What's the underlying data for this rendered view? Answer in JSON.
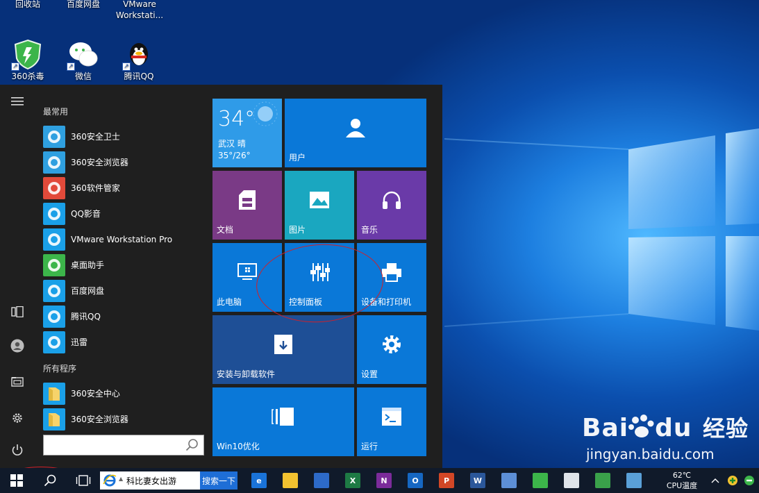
{
  "desktop": {
    "icons": [
      {
        "label": "回收站",
        "icon": "recycle-bin-icon"
      },
      {
        "label": "百度网盘",
        "icon": "baidu-netdisk-icon"
      },
      {
        "label": "VMware Workstati...",
        "icon": "vmware-icon"
      },
      {
        "label": "360杀毒",
        "icon": "360-antivirus-icon"
      },
      {
        "label": "微信",
        "icon": "wechat-icon"
      },
      {
        "label": "腾讯QQ",
        "icon": "qq-penguin-icon"
      }
    ]
  },
  "start_menu": {
    "most_used_header": "最常用",
    "all_programs_header": "所有程序",
    "most_used": [
      {
        "label": "360安全卫士",
        "color": "#2fa0e0",
        "icon": "360-security-icon"
      },
      {
        "label": "360安全浏览器",
        "color": "#2fa0e0",
        "icon": "360-browser-icon"
      },
      {
        "label": "360软件管家",
        "color": "#e24a3a",
        "icon": "360-software-icon"
      },
      {
        "label": "QQ影音",
        "color": "#1aa0e8",
        "icon": "qq-player-icon"
      },
      {
        "label": "VMware Workstation Pro",
        "color": "#1aa0e8",
        "icon": "vmware-icon"
      },
      {
        "label": "桌面助手",
        "color": "#3cb54a",
        "icon": "desktop-helper-icon"
      },
      {
        "label": "百度网盘",
        "color": "#1aa0e8",
        "icon": "baidu-netdisk-icon"
      },
      {
        "label": "腾讯QQ",
        "color": "#1aa0e8",
        "icon": "qq-penguin-icon"
      },
      {
        "label": "迅雷",
        "color": "#1aa0e8",
        "icon": "xunlei-icon"
      }
    ],
    "all_programs": [
      {
        "label": "360安全中心",
        "color": "#1aa0e8",
        "icon": "folder-icon"
      },
      {
        "label": "360安全浏览器",
        "color": "#1aa0e8",
        "icon": "folder-icon"
      }
    ],
    "search_placeholder": "",
    "tiles": {
      "weather": {
        "temp": "34°",
        "city": "武汉 晴",
        "range": "35°/26°",
        "color": "#2f9be8"
      },
      "user": {
        "label": "用户",
        "color": "#0a78d8"
      },
      "documents": {
        "label": "文档",
        "color": "#7a3a86"
      },
      "pictures": {
        "label": "图片",
        "color": "#1aa7c0"
      },
      "music": {
        "label": "音乐",
        "color": "#6a3aa8"
      },
      "this_pc": {
        "label": "此电脑",
        "color": "#0a78d8"
      },
      "control_panel": {
        "label": "控制面板",
        "color": "#0a78d8"
      },
      "devices_printers": {
        "label": "设备和打印机",
        "color": "#0a78d8"
      },
      "install_uninstall": {
        "label": "安装与卸载软件",
        "color": "#1e4f96"
      },
      "settings": {
        "label": "设置",
        "color": "#0a78d8"
      },
      "win10_optimize": {
        "label": "Win10优化",
        "color": "#0a78d8"
      },
      "run": {
        "label": "运行",
        "color": "#0a78d8"
      }
    }
  },
  "taskbar": {
    "ie_search_text": "科比妻女出游",
    "search_button": "搜索一下",
    "temp_value": "62℃",
    "temp_label": "CPU温度",
    "apps": [
      {
        "icon": "edge-icon",
        "text": "e",
        "color": "#1a73d8"
      },
      {
        "icon": "file-explorer-icon",
        "text": "",
        "color": "#f2c230"
      },
      {
        "icon": "store-icon",
        "text": "",
        "color": "#2d6ac8"
      },
      {
        "icon": "excel-icon",
        "text": "X",
        "color": "#1e7a44"
      },
      {
        "icon": "onenote-icon",
        "text": "N",
        "color": "#7b2b9a"
      },
      {
        "icon": "outlook-icon",
        "text": "O",
        "color": "#1667c2"
      },
      {
        "icon": "powerpoint-icon",
        "text": "P",
        "color": "#d24726"
      },
      {
        "icon": "word-icon",
        "text": "W",
        "color": "#2b579a"
      },
      {
        "icon": "paint-icon",
        "text": "",
        "color": "#5d8fd6"
      },
      {
        "icon": "360-security-icon",
        "text": "",
        "color": "#3cb54a"
      },
      {
        "icon": "clock-icon",
        "text": "",
        "color": "#dfe4ea"
      },
      {
        "icon": "photos-icon",
        "text": "",
        "color": "#3aa14a"
      },
      {
        "icon": "remote-desktop-icon",
        "text": "",
        "color": "#5aa0d8"
      }
    ]
  },
  "watermark": {
    "brand": "Bai",
    "brand2": "du",
    "cn": "经验",
    "url": "jingyan.baidu.com"
  }
}
